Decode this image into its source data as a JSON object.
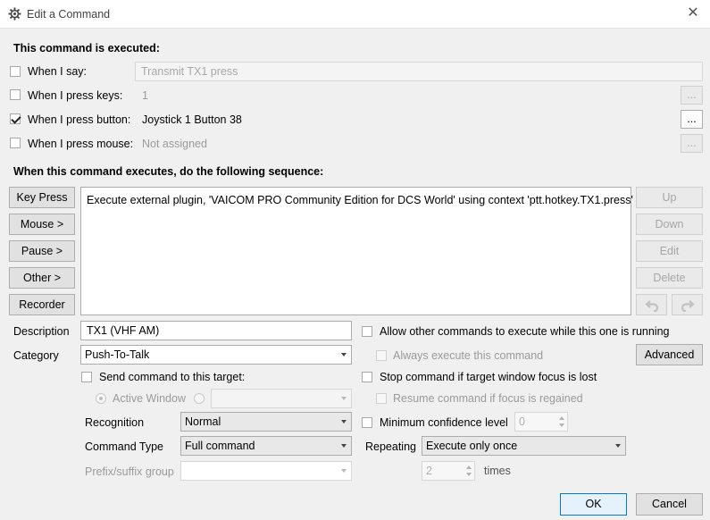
{
  "window": {
    "title": "Edit a Command",
    "close_glyph": "✕"
  },
  "trigger": {
    "heading": "This command is executed:",
    "say": {
      "label": "When I say:",
      "value": "Transmit TX1 press",
      "checked": false
    },
    "keys": {
      "label": "When I press keys:",
      "value": "1",
      "checked": false,
      "button": "..."
    },
    "button": {
      "label": "When I press button:",
      "value": "Joystick 1 Button 38",
      "checked": true,
      "button": "..."
    },
    "mouse": {
      "label": "When I press mouse:",
      "value": "Not assigned",
      "checked": false,
      "button": "..."
    }
  },
  "sequence": {
    "heading": "When this command executes, do the following sequence:",
    "left_buttons": {
      "key_press": "Key Press",
      "mouse": "Mouse >",
      "pause": "Pause >",
      "other": "Other >",
      "recorder": "Recorder"
    },
    "items": [
      "Execute external plugin, 'VAICOM PRO Community Edition for DCS World' using context 'ptt.hotkey.TX1.press'"
    ],
    "right_buttons": {
      "up": "Up",
      "down": "Down",
      "edit": "Edit",
      "delete": "Delete"
    }
  },
  "form": {
    "description_label": "Description",
    "description_value": "TX1 (VHF AM)",
    "category_label": "Category",
    "category_value": "Push-To-Talk",
    "send_target_label": "Send command to this target:",
    "active_window_label": "Active Window",
    "recognition_label": "Recognition",
    "recognition_value": "Normal",
    "command_type_label": "Command Type",
    "command_type_value": "Full command",
    "prefix_label": "Prefix/suffix group",
    "prefix_value": ""
  },
  "options": {
    "allow_other": "Allow other commands to execute while this one is running",
    "always_execute": "Always execute this command",
    "advanced": "Advanced",
    "stop_on_focus": "Stop command if target window focus is lost",
    "resume_on_focus": "Resume command if focus is regained",
    "min_conf": "Minimum confidence level",
    "min_conf_value": "0",
    "repeating_label": "Repeating",
    "repeating_value": "Execute only once",
    "times_value": "2",
    "times_label": "times"
  },
  "footer": {
    "ok": "OK",
    "cancel": "Cancel"
  }
}
